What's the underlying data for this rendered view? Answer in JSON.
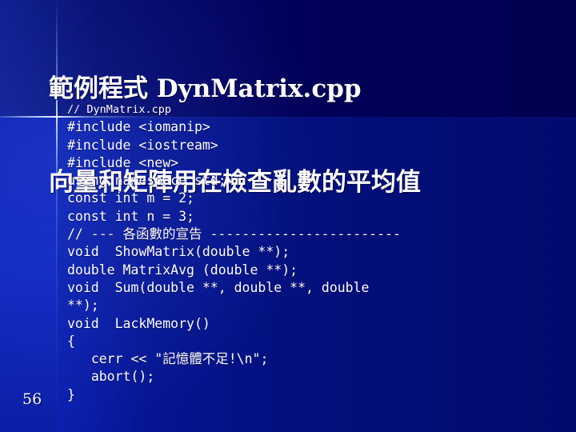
{
  "slide": {
    "page_number": "56",
    "background_color": "#000066",
    "accent_color": "#c8e0ff",
    "text_color": "#ffffff",
    "title": {
      "line1": "範例程式 DynMatrix.cpp",
      "line2": "向量和矩陣用在檢查亂數的平均值"
    },
    "code": {
      "language": "cpp",
      "lines": [
        "// DynMatrix.cpp",
        "#include <iomanip>",
        "#include <iostream>",
        "#include <new>",
        "using namespace std;",
        "const int m = 2;",
        "const int n = 3;",
        "// --- 各函數的宣告 ------------------------",
        "void  ShowMatrix(double **);",
        "double MatrixAvg (double **);",
        "void  Sum(double **, double **, double **);",
        "void  LackMemory()",
        "{",
        "   cerr << \"記憶體不足!\\n\";",
        "   abort();",
        "}"
      ]
    }
  }
}
